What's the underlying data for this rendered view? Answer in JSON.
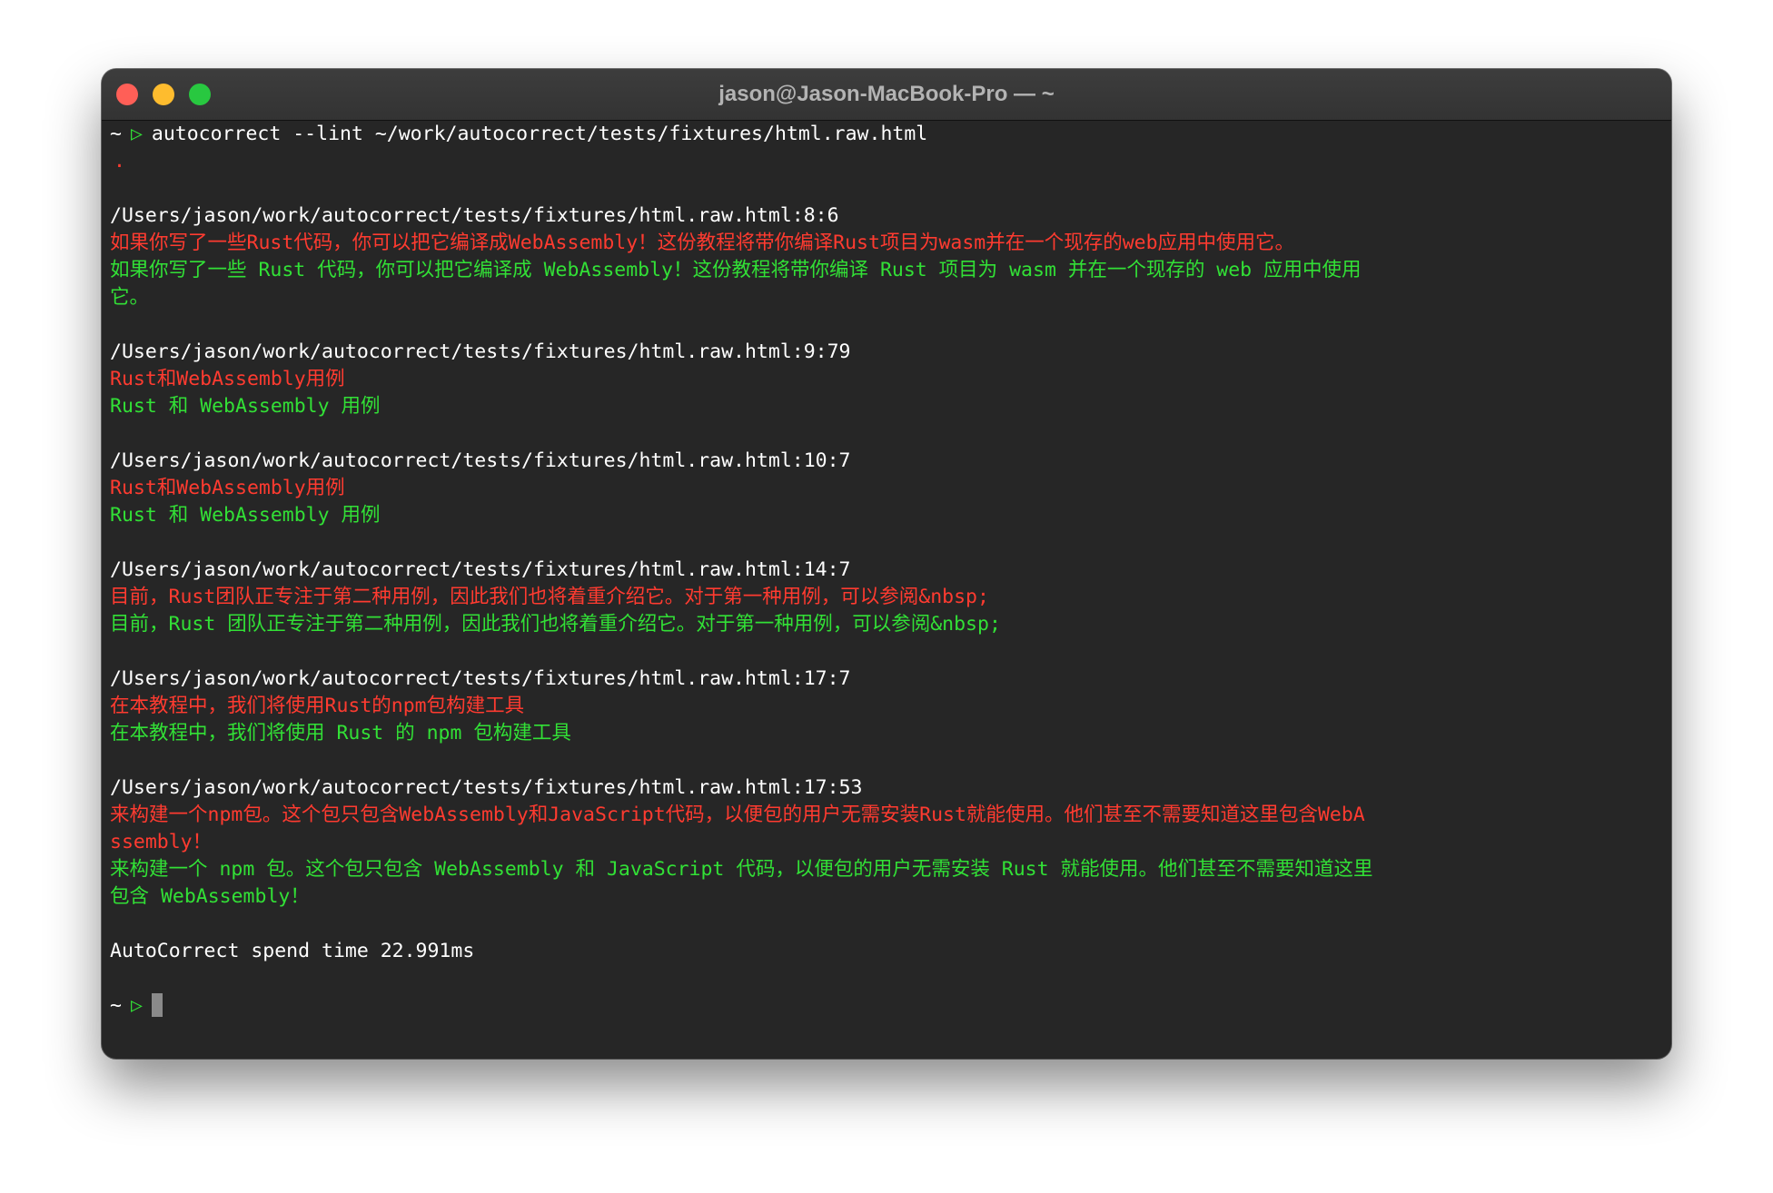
{
  "window": {
    "title": "jason@Jason-MacBook-Pro — ~"
  },
  "prompt": {
    "tilde": "~",
    "arrow": "▷",
    "command": "autocorrect --lint ~/work/autocorrect/tests/fixtures/html.raw.html",
    "progress_dot": "."
  },
  "results": [
    {
      "path": "/Users/jason/work/autocorrect/tests/fixtures/html.raw.html:8:6",
      "old": [
        "如果你写了一些Rust代码，你可以把它编译成WebAssembly！这份教程将带你编译Rust项目为wasm并在一个现存的web应用中使用它。"
      ],
      "new": [
        "如果你写了一些 Rust 代码，你可以把它编译成 WebAssembly！这份教程将带你编译 Rust 项目为 wasm 并在一个现存的 web 应用中使用",
        "它。"
      ]
    },
    {
      "path": "/Users/jason/work/autocorrect/tests/fixtures/html.raw.html:9:79",
      "old": [
        "Rust和WebAssembly用例"
      ],
      "new": [
        "Rust 和 WebAssembly 用例"
      ]
    },
    {
      "path": "/Users/jason/work/autocorrect/tests/fixtures/html.raw.html:10:7",
      "old": [
        "Rust和WebAssembly用例"
      ],
      "new": [
        "Rust 和 WebAssembly 用例"
      ]
    },
    {
      "path": "/Users/jason/work/autocorrect/tests/fixtures/html.raw.html:14:7",
      "old": [
        "目前，Rust团队正专注于第二种用例，因此我们也将着重介绍它。对于第一种用例，可以参阅&nbsp;"
      ],
      "new": [
        "目前，Rust 团队正专注于第二种用例，因此我们也将着重介绍它。对于第一种用例，可以参阅&nbsp;"
      ]
    },
    {
      "path": "/Users/jason/work/autocorrect/tests/fixtures/html.raw.html:17:7",
      "old": [
        "在本教程中，我们将使用Rust的npm包构建工具"
      ],
      "new": [
        "在本教程中，我们将使用 Rust 的 npm 包构建工具"
      ]
    },
    {
      "path": "/Users/jason/work/autocorrect/tests/fixtures/html.raw.html:17:53",
      "old": [
        "来构建一个npm包。这个包只包含WebAssembly和JavaScript代码，以便包的用户无需安装Rust就能使用。他们甚至不需要知道这里包含WebA",
        "ssembly！"
      ],
      "new": [
        "来构建一个 npm 包。这个包只包含 WebAssembly 和 JavaScript 代码，以便包的用户无需安装 Rust 就能使用。他们甚至不需要知道这里",
        "包含 WebAssembly！"
      ]
    }
  ],
  "summary": "AutoCorrect spend time 22.991ms",
  "colors": {
    "error": "#ff3b30",
    "fixed": "#32e036",
    "background": "#262626"
  }
}
